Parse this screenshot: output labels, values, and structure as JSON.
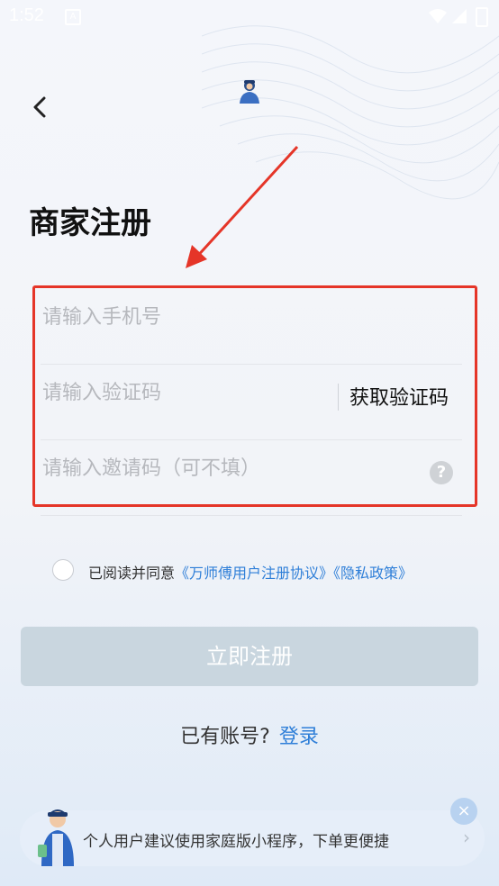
{
  "status_bar": {
    "time": "1:52"
  },
  "page": {
    "title": "商家注册"
  },
  "form": {
    "phone_placeholder": "请输入手机号",
    "code_placeholder": "请输入验证码",
    "get_code_label": "获取验证码",
    "invite_placeholder": "请输入邀请码（可不填）",
    "help_symbol": "?"
  },
  "agreement": {
    "prefix": "已阅读并同意",
    "user_agreement": "《万师傅用户注册协议》",
    "privacy_policy": "《隐私政策》"
  },
  "register_button": "立即注册",
  "login": {
    "prompt": "已有账号?",
    "link": "登录"
  },
  "banner": {
    "text": "个人用户建议使用家庭版小程序，下单更便捷",
    "chevron": "›",
    "close": "×"
  },
  "colors": {
    "accent": "#2f7fd8",
    "highlight_border": "#e53528",
    "button_disabled": "#c9d6df"
  },
  "icons": [
    "back-icon",
    "logo-icon",
    "help-icon",
    "close-icon",
    "chevron-right-icon",
    "wifi-icon",
    "signal-icon",
    "battery-icon"
  ]
}
